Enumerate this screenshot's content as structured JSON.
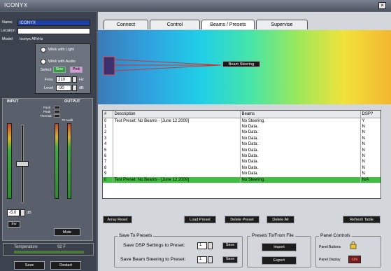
{
  "window": {
    "title": "ICONYX",
    "close": "×"
  },
  "left": {
    "name_label": "Name",
    "name_value": "ICONYX",
    "location_label": "Location",
    "location_value": "",
    "model_label": "Model",
    "model_value": "Iconyx ARrHz",
    "wink_light": "Wink with Light",
    "wink_audio": "Wink with Audio",
    "select_label": "Select",
    "sel_a": "Sine",
    "sel_b": "Pink",
    "freq_label": "Freq",
    "freq_value": "210",
    "freq_unit": "Hz",
    "level_label": "Level",
    "level_value": "-30",
    "level_unit": "dB",
    "input_label": "INPUT",
    "output_label": "OUTPUT",
    "fault_label": "Fault",
    "peak_label": "Peak",
    "thermal_label": "Thermal",
    "limit_label": "70 Audit",
    "gain_value": "-5.0",
    "gain_unit": "dB",
    "inv_button": "Inv",
    "mute_button": "Mute",
    "temperature_label": "Temperature",
    "temperature_value": "92 F",
    "save_button": "Save",
    "restart_button": "Restart"
  },
  "tabs": [
    "Connect",
    "Control",
    "Beams / Presets",
    "Supervise"
  ],
  "beam_plot": {
    "label": "Beam Steering"
  },
  "table": {
    "headers": [
      "#",
      "Description",
      "Beams",
      "DSP?"
    ],
    "rows": [
      [
        "0",
        "Test Preset: No Beams - [June 12 2009]",
        "No Steering.",
        "Y"
      ],
      [
        "1",
        "",
        "No Data.",
        "N"
      ],
      [
        "2",
        "",
        "No Data.",
        "N"
      ],
      [
        "3",
        "",
        "No Data.",
        "N"
      ],
      [
        "4",
        "",
        "No Data.",
        "N"
      ],
      [
        "5",
        "",
        "No Data.",
        "N"
      ],
      [
        "6",
        "",
        "No Data.",
        "N"
      ],
      [
        "7",
        "",
        "No Data.",
        "N"
      ],
      [
        "8",
        "",
        "No Data.",
        "N"
      ],
      [
        "9",
        "",
        "No Data.",
        "N"
      ],
      [
        "0",
        "Test Preset: No Beams - [June 12 2009]",
        "No Steering.",
        "N/A"
      ]
    ]
  },
  "buttons": {
    "array_reset": "Array Reset",
    "load_preset": "Load Preset",
    "delete_preset": "Delete Preset",
    "delete_all": "Delete All",
    "refresh_table": "Refresh Table"
  },
  "save_group": {
    "title": "Save To Presets",
    "dsp_label": "Save DSP Settings to Preset:",
    "dsp_value": "1",
    "beam_label": "Save Beam Steering to Preset:",
    "beam_value": "1",
    "save": "Save"
  },
  "file_group": {
    "title": "Presets To/From File",
    "import": "Import",
    "export": "Export"
  },
  "panel_group": {
    "title": "Panel Controls",
    "buttons_label": "Panel Buttons",
    "display_label": "Panel Display",
    "display_state": "ON"
  },
  "colors": {
    "highlight": "#3fbf3f",
    "accent_blue": "#1c3fa8"
  }
}
